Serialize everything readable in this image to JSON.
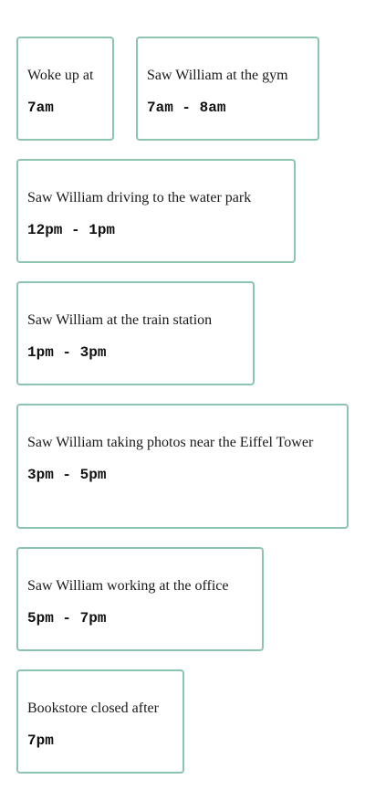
{
  "cards": [
    {
      "text": "Woke up at",
      "time": "7am"
    },
    {
      "text": "Saw William at the gym",
      "time": "7am - 8am"
    },
    {
      "text": "Saw William driving to the water park",
      "time": "12pm - 1pm"
    },
    {
      "text": "Saw William at the train station",
      "time": "1pm - 3pm"
    },
    {
      "text": "Saw William taking photos near the Eiffel Tower",
      "time": "3pm - 5pm"
    },
    {
      "text": "Saw William working at the office",
      "time": "5pm - 7pm"
    },
    {
      "text": "Bookstore closed after",
      "time": "7pm"
    }
  ]
}
